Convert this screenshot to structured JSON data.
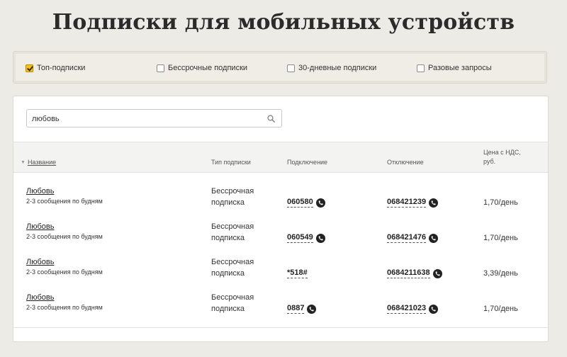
{
  "page": {
    "title": "Подписки для мобильных устройств"
  },
  "filters": [
    {
      "label": "Топ-подписки",
      "checked": true
    },
    {
      "label": "Бессрочные подписки",
      "checked": false
    },
    {
      "label": "30-дневные подписки",
      "checked": false
    },
    {
      "label": "Разовые запросы",
      "checked": false
    }
  ],
  "search": {
    "value": "любовь",
    "icon": "search-icon"
  },
  "table": {
    "headers": {
      "name": "Название",
      "type": "Тип подписки",
      "connect": "Подключение",
      "disconnect": "Отключение",
      "price_line1": "Цена с НДС,",
      "price_line2": "руб."
    },
    "rows": [
      {
        "name": "Любовь",
        "desc": "2-3 сообщения по будням",
        "type_line1": "Бессрочная",
        "type_line2": "подписка",
        "connect": "060580",
        "disconnect": "068421239",
        "price": "1,70/день"
      },
      {
        "name": "Любовь",
        "desc": "2-3 сообщения по будням",
        "type_line1": "Бессрочная",
        "type_line2": "подписка",
        "connect": "060549",
        "disconnect": "068421476",
        "price": "1,70/день"
      },
      {
        "name": "Любовь",
        "desc": "2-3 сообщения по будням",
        "type_line1": "Бессрочная",
        "type_line2": "подписка",
        "connect": "*518#",
        "disconnect": "0684211638",
        "price": "3,39/день"
      },
      {
        "name": "Любовь",
        "desc": "2-3 сообщения по будням",
        "type_line1": "Бессрочная",
        "type_line2": "подписка",
        "connect": "0887",
        "disconnect": "068421023",
        "price": "1,70/день"
      }
    ]
  },
  "colors": {
    "accent": "#f5c41a",
    "background": "#edebe6"
  },
  "icons": {
    "phone": "phone-icon",
    "sort": "sort-arrow-icon"
  }
}
